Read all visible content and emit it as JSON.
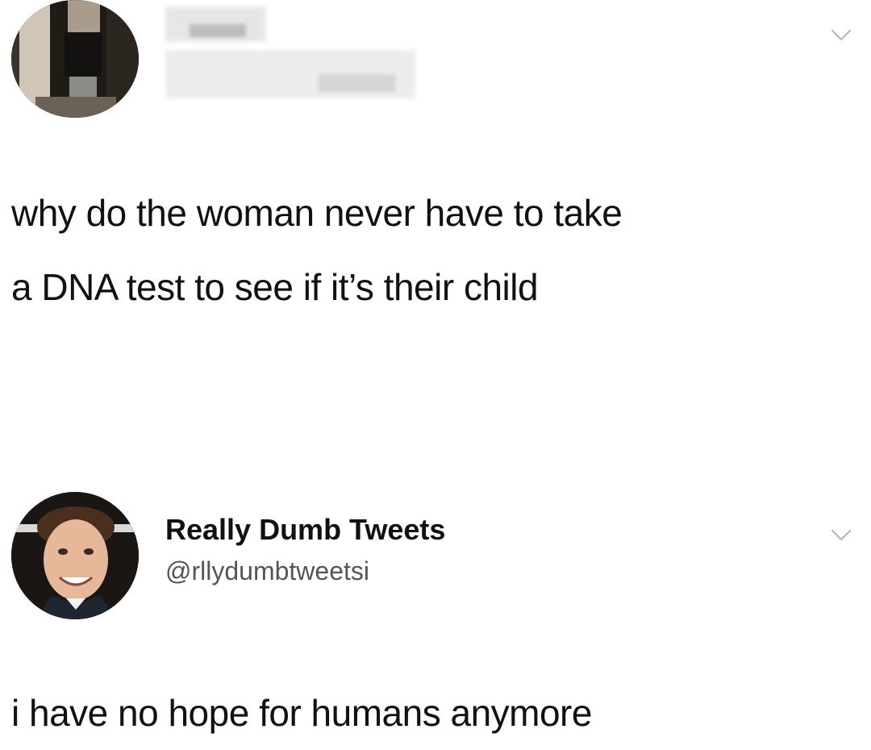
{
  "tweets": [
    {
      "display_name": "",
      "handle": "",
      "text_line_1": "why do the woman never have to take",
      "text_line_2": "a DNA test to see if it’s their child",
      "avatar_icon": "photo-avatar-icon",
      "menu_icon": "chevron-down-icon"
    },
    {
      "display_name": "Really Dumb Tweets",
      "handle": "@rllydumbtweetsi",
      "text_line_1": "i have no hope for humans anymore",
      "avatar_icon": "face-avatar-icon",
      "menu_icon": "chevron-down-icon"
    }
  ],
  "colors": {
    "background": "#ffffff",
    "text": "#111111",
    "handle": "#555555",
    "chevron": "#b8b8b8"
  }
}
